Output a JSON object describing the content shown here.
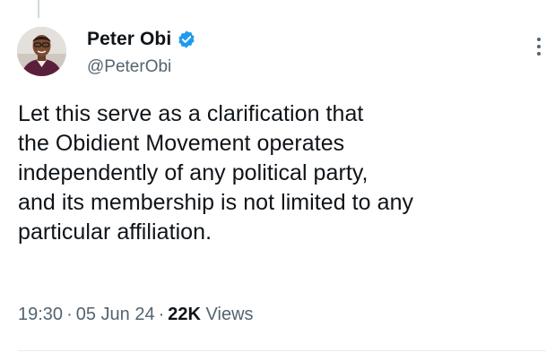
{
  "tweet": {
    "author": {
      "display_name": "Peter Obi",
      "handle": "@PeterObi",
      "verified": true,
      "verified_color": "#1d9bf0"
    },
    "text": "Let this serve as a clarification that\nthe Obidient Movement operates\nindependently of any political party,\nand its membership is not limited to any\nparticular affiliation.",
    "time": "19:30",
    "date": "05 Jun 24",
    "views_count": "22K",
    "views_label": "Views",
    "separator": "·"
  },
  "icons": {
    "more": "more-icon",
    "verified": "verified-badge-icon",
    "avatar": "avatar-photo"
  }
}
